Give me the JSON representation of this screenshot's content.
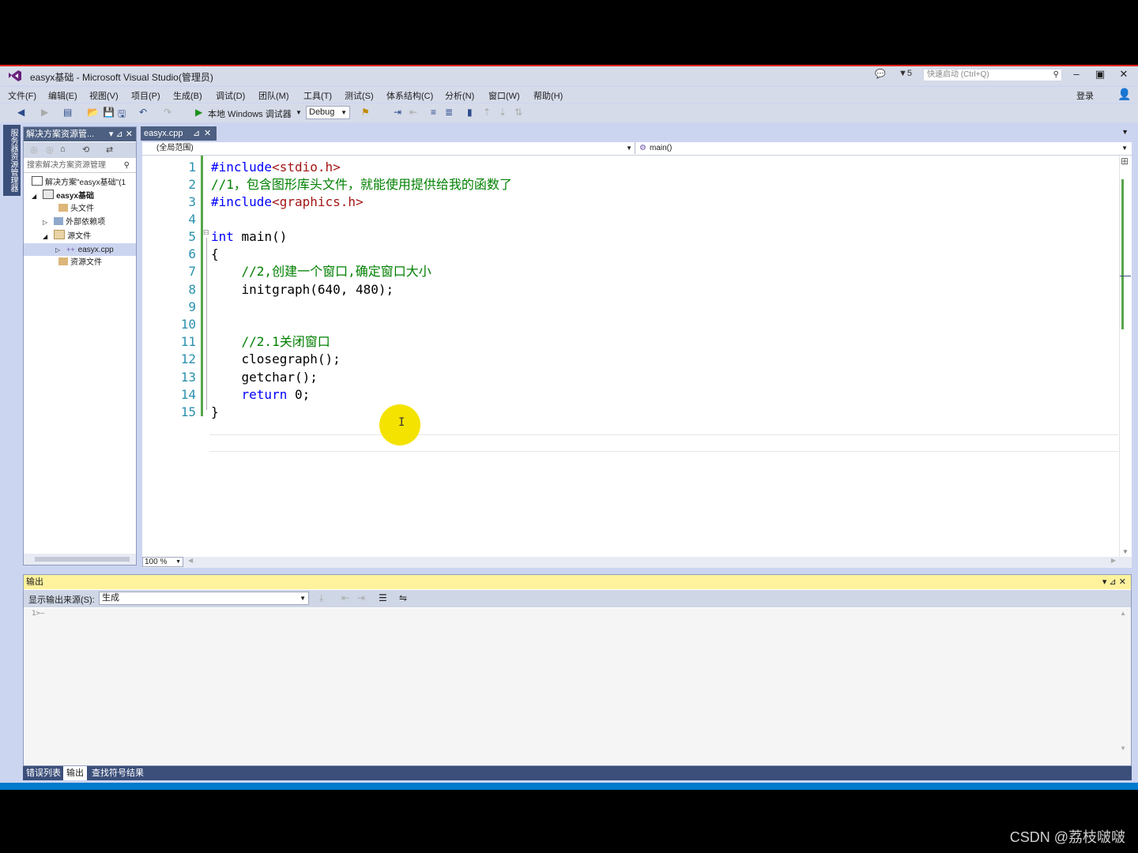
{
  "window": {
    "title": "easyx基础 - Microsoft Visual Studio(管理员)",
    "notifications": "5",
    "quick_launch_placeholder": "快速启动 (Ctrl+Q)",
    "signin": "登录"
  },
  "menu": [
    "文件(F)",
    "编辑(E)",
    "视图(V)",
    "项目(P)",
    "生成(B)",
    "调试(D)",
    "团队(M)",
    "工具(T)",
    "测试(S)",
    "体系结构(C)",
    "分析(N)",
    "窗口(W)",
    "帮助(H)"
  ],
  "toolbar": {
    "run_label": "本地 Windows 调试器",
    "config": "Debug"
  },
  "side_strip": "服务器资源管理器",
  "solution_explorer": {
    "title": "解决方案资源管...",
    "search_placeholder": "搜索解决方案资源管理",
    "tree": [
      {
        "label": "解决方案\"easyx基础\"(1"
      },
      {
        "label": "easyx基础"
      },
      {
        "label": "头文件"
      },
      {
        "label": "外部依赖项"
      },
      {
        "label": "源文件"
      },
      {
        "label": "easyx.cpp"
      },
      {
        "label": "资源文件"
      }
    ]
  },
  "editor": {
    "tab": "easyx.cpp",
    "scope": "(全局范围)",
    "member": "main()",
    "zoom": "100 %",
    "lines": [
      {
        "n": "1",
        "text": "#include<stdio.h>"
      },
      {
        "n": "2",
        "text": "//1，包含图形库头文件，就能使用提供给我的函数了"
      },
      {
        "n": "3",
        "text": "#include<graphics.h>"
      },
      {
        "n": "4",
        "text": ""
      },
      {
        "n": "5",
        "text": "int main()"
      },
      {
        "n": "6",
        "text": "{"
      },
      {
        "n": "7",
        "text": "    //2,创建一个窗口,确定窗口大小"
      },
      {
        "n": "8",
        "text": "    initgraph(640, 480);"
      },
      {
        "n": "9",
        "text": ""
      },
      {
        "n": "10",
        "text": ""
      },
      {
        "n": "11",
        "text": "    //2.1关闭窗口"
      },
      {
        "n": "12",
        "text": "    closegraph();"
      },
      {
        "n": "13",
        "text": "    getchar();"
      },
      {
        "n": "14",
        "text": "    return 0;"
      },
      {
        "n": "15",
        "text": "}"
      }
    ]
  },
  "output": {
    "title": "输出",
    "source_label": "显示输出来源(S):",
    "source_value": "生成",
    "content": "1>—"
  },
  "bottom_tabs": [
    "错误列表",
    "输出",
    "查找符号结果"
  ],
  "watermark": "CSDN @荔枝啵啵",
  "colors": {
    "accent": "#007acc",
    "chrome": "#D6DBE9",
    "keyword": "#0000ff",
    "comment": "#008000",
    "preprocessor": "#808080",
    "linenumber": "#2b91af"
  }
}
